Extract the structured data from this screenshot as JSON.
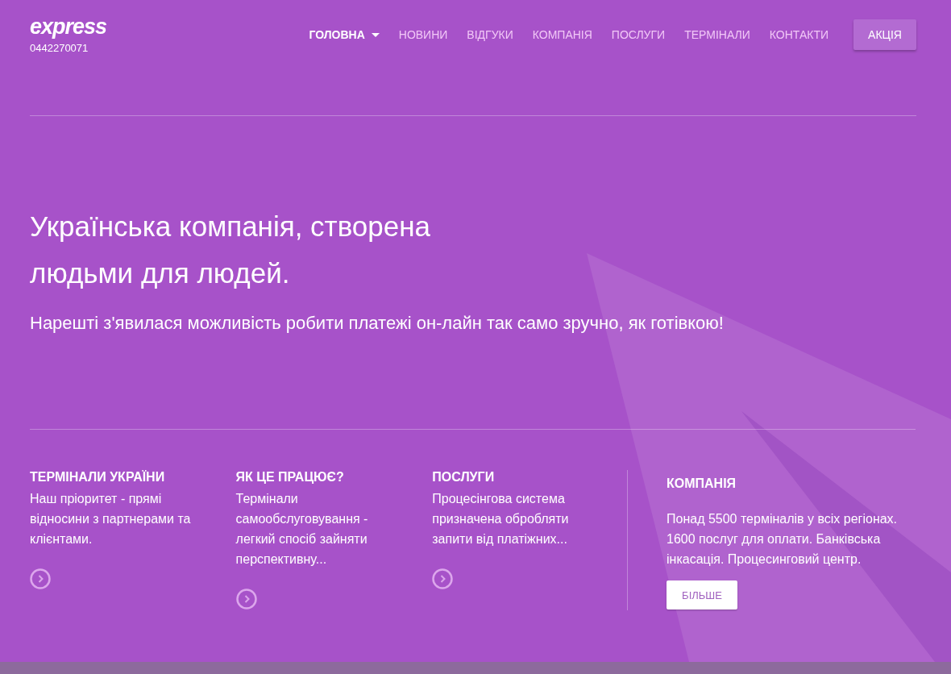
{
  "header": {
    "logo": "express",
    "phone": "0442270071"
  },
  "nav": [
    {
      "label": "ГОЛОВНА",
      "selected": true,
      "dropdown": true
    },
    {
      "label": "НОВИНИ",
      "selected": false,
      "dropdown": false
    },
    {
      "label": "ВІДГУКИ",
      "selected": false,
      "dropdown": false
    },
    {
      "label": "КОМПАНІЯ",
      "selected": false,
      "dropdown": false
    },
    {
      "label": "ПОСЛУГИ",
      "selected": false,
      "dropdown": false
    },
    {
      "label": "ТЕРМІНАЛИ",
      "selected": false,
      "dropdown": false
    },
    {
      "label": "КОНТАКТИ",
      "selected": false,
      "dropdown": false
    }
  ],
  "promo_button": "АКЦІЯ",
  "hero": {
    "title_lines": [
      "Українська компанія, створена",
      "людьми для людей."
    ],
    "subtitle": "Нарешті з'явилася можливість робити платежі он-лайн так само зручно, як готівкою!"
  },
  "features": [
    {
      "title": "ТЕРМІНАЛИ УКРАЇНИ",
      "text": "Наш пріоритет - прямі відносини з партнерами та клієнтами."
    },
    {
      "title": "ЯК ЦЕ ПРАЦЮЄ?",
      "text": "Термінали самообслуговування - легкий спосіб зайняти перспективну..."
    },
    {
      "title": "ПОСЛУГИ",
      "text": "Процесінгова система призначена обробляти запити від платіжних..."
    }
  ],
  "company": {
    "title": "КОМПАНІЯ",
    "text": "Понад 5500 терміналів у всіх регіонах. 1600 послуг для оплати. Банківська інкасація. Процесинговий центр.",
    "button": "БІЛЬШЕ"
  }
}
